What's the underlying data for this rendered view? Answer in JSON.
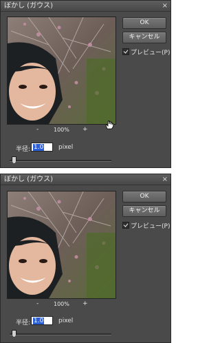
{
  "dialog_top": {
    "title": "ぼかし (ガウス)",
    "close": "×",
    "ok": "OK",
    "cancel": "キャンセル",
    "preview_label": "プレビュー(P)",
    "preview_checked": true,
    "zoom_minus": "-",
    "zoom": "100%",
    "zoom_plus": "+",
    "radius_label": "半径:",
    "radius_value": "1.0",
    "radius_unit": "pixel",
    "slider_level": 0.04
  },
  "dialog_bottom": {
    "title": "ぼかし (ガウス)",
    "close": "×",
    "ok": "OK",
    "cancel": "キャンセル",
    "preview_label": "プレビュー(P)",
    "preview_checked": true,
    "zoom_minus": "-",
    "zoom": "100%",
    "zoom_plus": "+",
    "radius_label": "半径:",
    "radius_value": "1.0",
    "radius_unit": "pixel",
    "slider_level": 0.04
  },
  "colors": {
    "dialog_bg": "#4a4a4a",
    "selection": "#2a5fd8"
  },
  "icons": {
    "cursor": "hand-cursor-icon"
  }
}
